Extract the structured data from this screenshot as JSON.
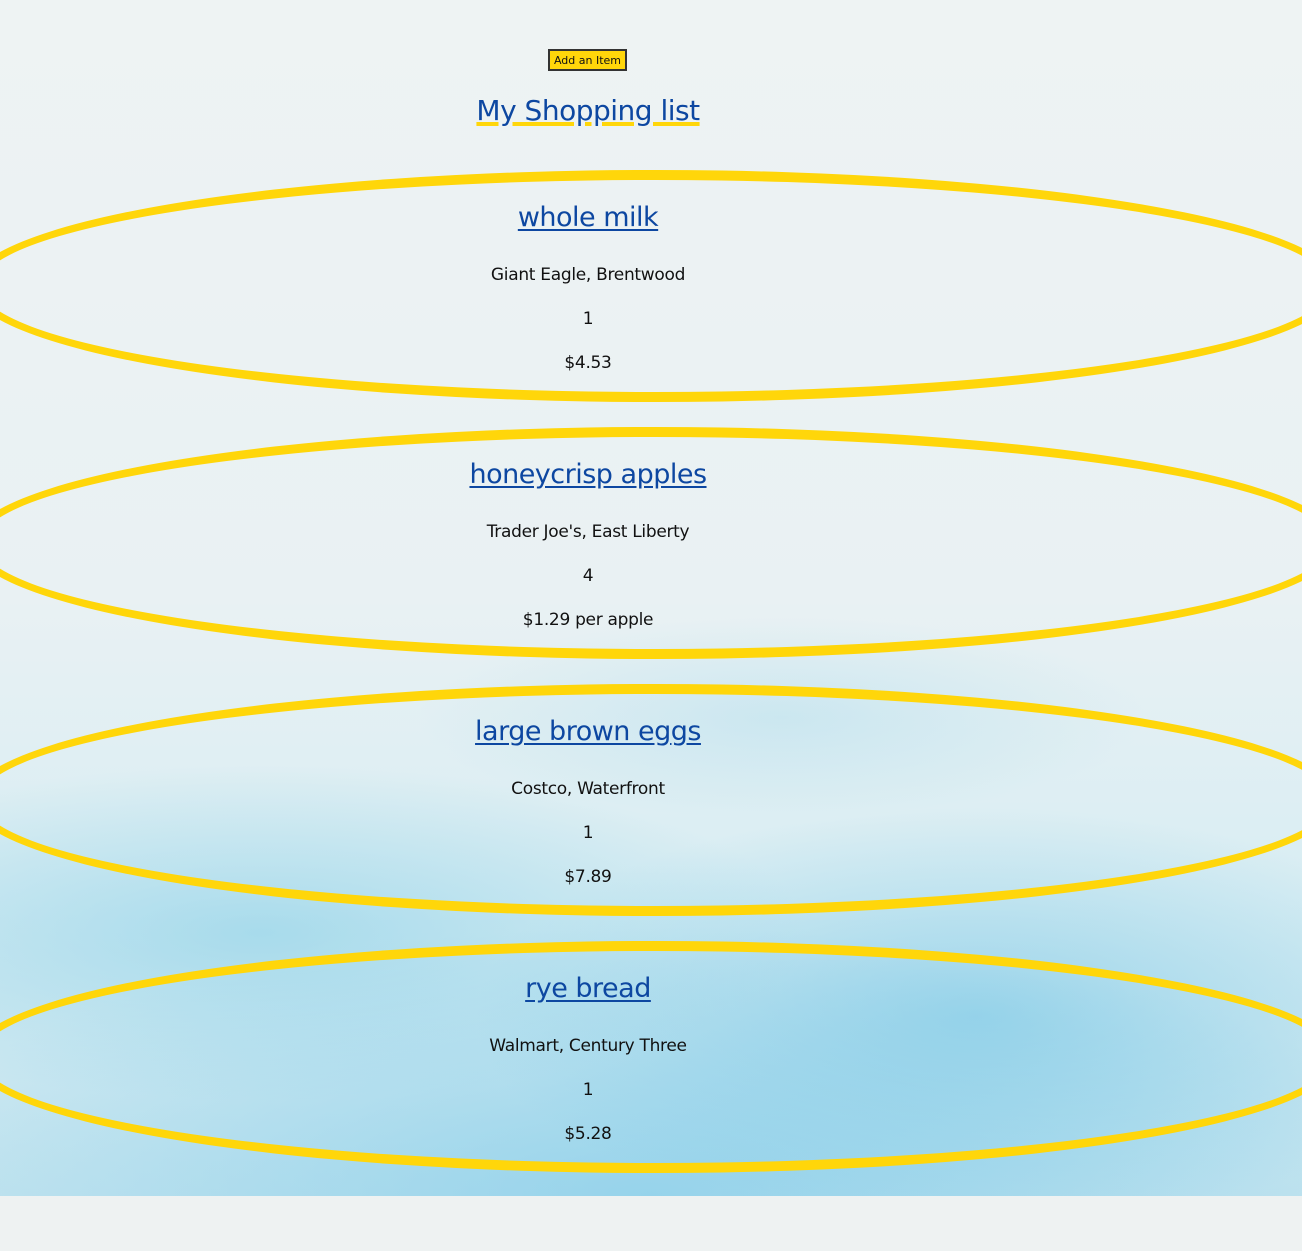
{
  "toolbar": {
    "add_label": "Add an Item"
  },
  "page": {
    "title": "My Shopping list"
  },
  "items": [
    {
      "name": "whole milk",
      "store": "Giant Eagle, Brentwood",
      "quantity": "1",
      "price": "$4.53"
    },
    {
      "name": "honeycrisp apples",
      "store": "Trader Joe's, East Liberty",
      "quantity": "4",
      "price": "$1.29 per apple"
    },
    {
      "name": "large brown eggs",
      "store": "Costco, Waterfront",
      "quantity": "1",
      "price": "$7.89"
    },
    {
      "name": "rye bread",
      "store": "Walmart, Century Three",
      "quantity": "1",
      "price": "$5.28"
    }
  ],
  "colors": {
    "accent": "#ffd60a",
    "title": "#0d47a1",
    "text": "#111111"
  }
}
